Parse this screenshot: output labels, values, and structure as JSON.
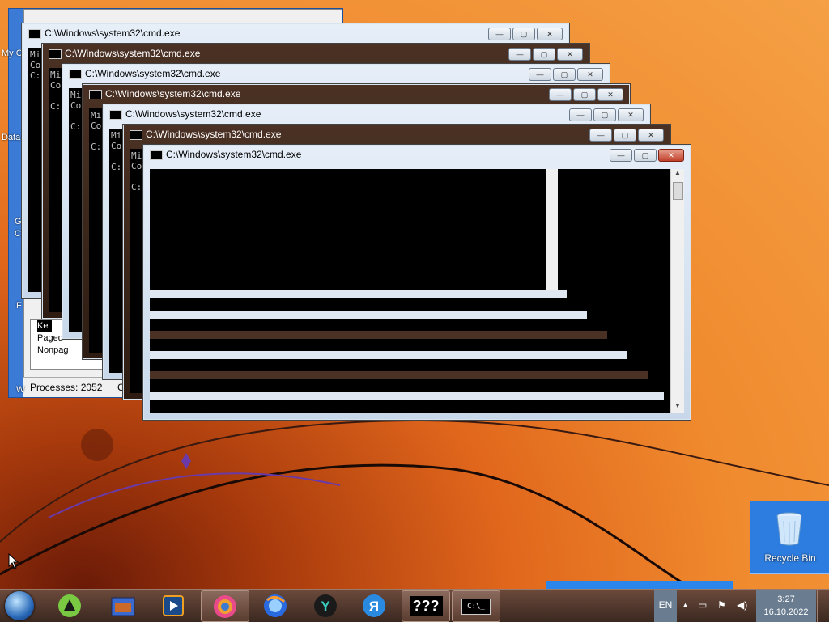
{
  "colors": {
    "desktop_orange": "#f08a2e",
    "taskbar_bg": "#3a2820",
    "recycle_highlight": "#2d7de0",
    "close_red": "#c0402a"
  },
  "desktop": {
    "icons": [
      {
        "label": "My C",
        "icon": "computer-icon"
      },
      {
        "label": "Data",
        "icon": "folder-icon"
      },
      {
        "label": "G",
        "icon": "chrome-icon"
      },
      {
        "label": "C",
        "icon": "chrome-icon"
      },
      {
        "label": "F",
        "icon": "app-icon"
      },
      {
        "label": "W",
        "icon": "app-icon"
      }
    ],
    "recycle_bin": {
      "label": "Recycle Bin",
      "icon": "recycle-bin-icon"
    }
  },
  "task_manager": {
    "list_items": [
      "Ke",
      "Paged",
      "Nonpag"
    ],
    "status_processes": "Processes: 2052",
    "status_next": "C"
  },
  "cmd_windows": [
    {
      "title": "C:\\Windows\\system32\\cmd.exe",
      "lines": [
        "Mi",
        "Co",
        "",
        "C:"
      ]
    },
    {
      "title": "C:\\Windows\\system32\\cmd.exe",
      "lines": [
        "Mi",
        "Co",
        "",
        "C:"
      ]
    },
    {
      "title": "C:\\Windows\\system32\\cmd.exe",
      "lines": [
        "Mi",
        "Co",
        "",
        "C:"
      ]
    },
    {
      "title": "C:\\Windows\\system32\\cmd.exe",
      "lines": [
        "Mi",
        "Co",
        "",
        "C:"
      ]
    },
    {
      "title": "C:\\Windows\\system32\\cmd.exe",
      "lines": [
        "Mi",
        "Co",
        "",
        "C:"
      ]
    },
    {
      "title": "C:\\Windows\\system32\\cmd.exe",
      "lines": [
        "Mi",
        "Co",
        "",
        "C:"
      ]
    },
    {
      "title": "C:\\Windows\\system32\\cmd.exe",
      "lines": [
        "",
        "",
        "",
        ""
      ]
    }
  ],
  "window_buttons": {
    "minimize": "—",
    "maximize": "▢",
    "close": "✕"
  },
  "taskbar": {
    "pinned": [
      {
        "name": "start-button"
      },
      {
        "name": "alice-icon",
        "glyph": "▲"
      },
      {
        "name": "explorer-icon",
        "glyph": "▦"
      },
      {
        "name": "media-player-icon",
        "glyph": "▶"
      },
      {
        "name": "chrome-icon",
        "glyph": "◉"
      },
      {
        "name": "firefox-icon",
        "glyph": "◍"
      },
      {
        "name": "yandex-icon",
        "glyph": "Y"
      },
      {
        "name": "yandex-browser-icon",
        "glyph": "Я"
      },
      {
        "name": "unknown-app-icon",
        "glyph": "???"
      },
      {
        "name": "cmd-icon",
        "glyph": "C:\\_"
      }
    ],
    "language": "EN",
    "clock_time": "3:27",
    "clock_date": "16.10.2022"
  }
}
